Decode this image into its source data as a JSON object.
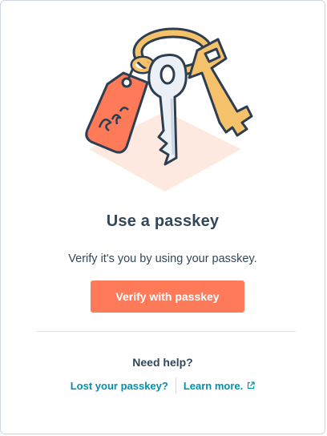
{
  "illustration": {
    "icon": "passkey-keys-illustration",
    "tag_text": "CRM"
  },
  "title": "Use a passkey",
  "subtitle": "Verify it's you by using your passkey.",
  "verify_button": {
    "label": "Verify with passkey",
    "color": "#ff7a59"
  },
  "help": {
    "title": "Need help?",
    "links": [
      {
        "label": "Lost your passkey?",
        "icon": ""
      },
      {
        "label": "Learn more.",
        "icon": "external-link-icon"
      }
    ]
  },
  "colors": {
    "text": "#33475b",
    "link": "#0091ae",
    "border": "#cbd6e2"
  }
}
